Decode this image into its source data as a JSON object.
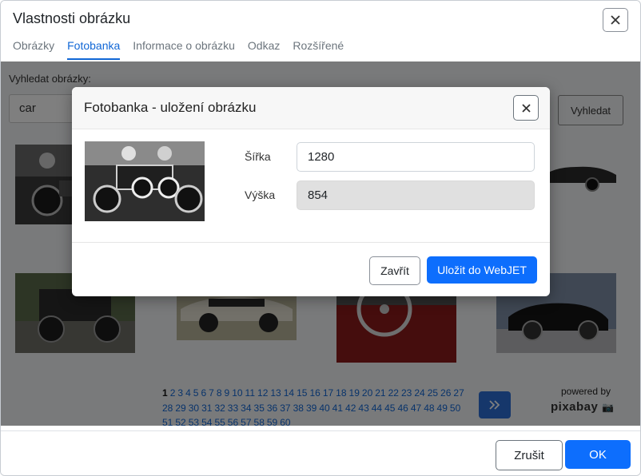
{
  "dialog": {
    "title": "Vlastnosti obrázku",
    "tabs": [
      "Obrázky",
      "Fotobanka",
      "Informace o obrázku",
      "Odkaz",
      "Rozšířené"
    ],
    "active_tab": "Fotobanka"
  },
  "search": {
    "label": "Vyhledat obrázky:",
    "value": "car",
    "button_label": "Vyhledat"
  },
  "pagination": {
    "current": "1",
    "pages": [
      "1",
      "2",
      "3",
      "4",
      "5",
      "6",
      "7",
      "8",
      "9",
      "10",
      "11",
      "12",
      "13",
      "14",
      "15",
      "16",
      "17",
      "18",
      "19",
      "20",
      "21",
      "22",
      "23",
      "24",
      "25",
      "26",
      "27",
      "28",
      "29",
      "30",
      "31",
      "32",
      "33",
      "34",
      "35",
      "36",
      "37",
      "38",
      "39",
      "40",
      "41",
      "42",
      "43",
      "44",
      "45",
      "46",
      "47",
      "48",
      "49",
      "50",
      "51",
      "52",
      "53",
      "54",
      "55",
      "56",
      "57",
      "58",
      "59",
      "60"
    ],
    "next_icon": "double-chevron-right-icon"
  },
  "powered_by": {
    "text": "powered by",
    "brand": "pixabay"
  },
  "footer": {
    "cancel_label": "Zrušit",
    "ok_label": "OK"
  },
  "modal": {
    "title": "Fotobanka - uložení obrázku",
    "width_label": "Šířka",
    "width_value": "1280",
    "height_label": "Výška",
    "height_value": "854",
    "close_label": "Zavřít",
    "save_label": "Uložit do WebJET"
  },
  "colors": {
    "accent": "#0d6efd",
    "tab_active": "#1167d6",
    "overlay": "rgba(0,0,0,0.5)"
  }
}
